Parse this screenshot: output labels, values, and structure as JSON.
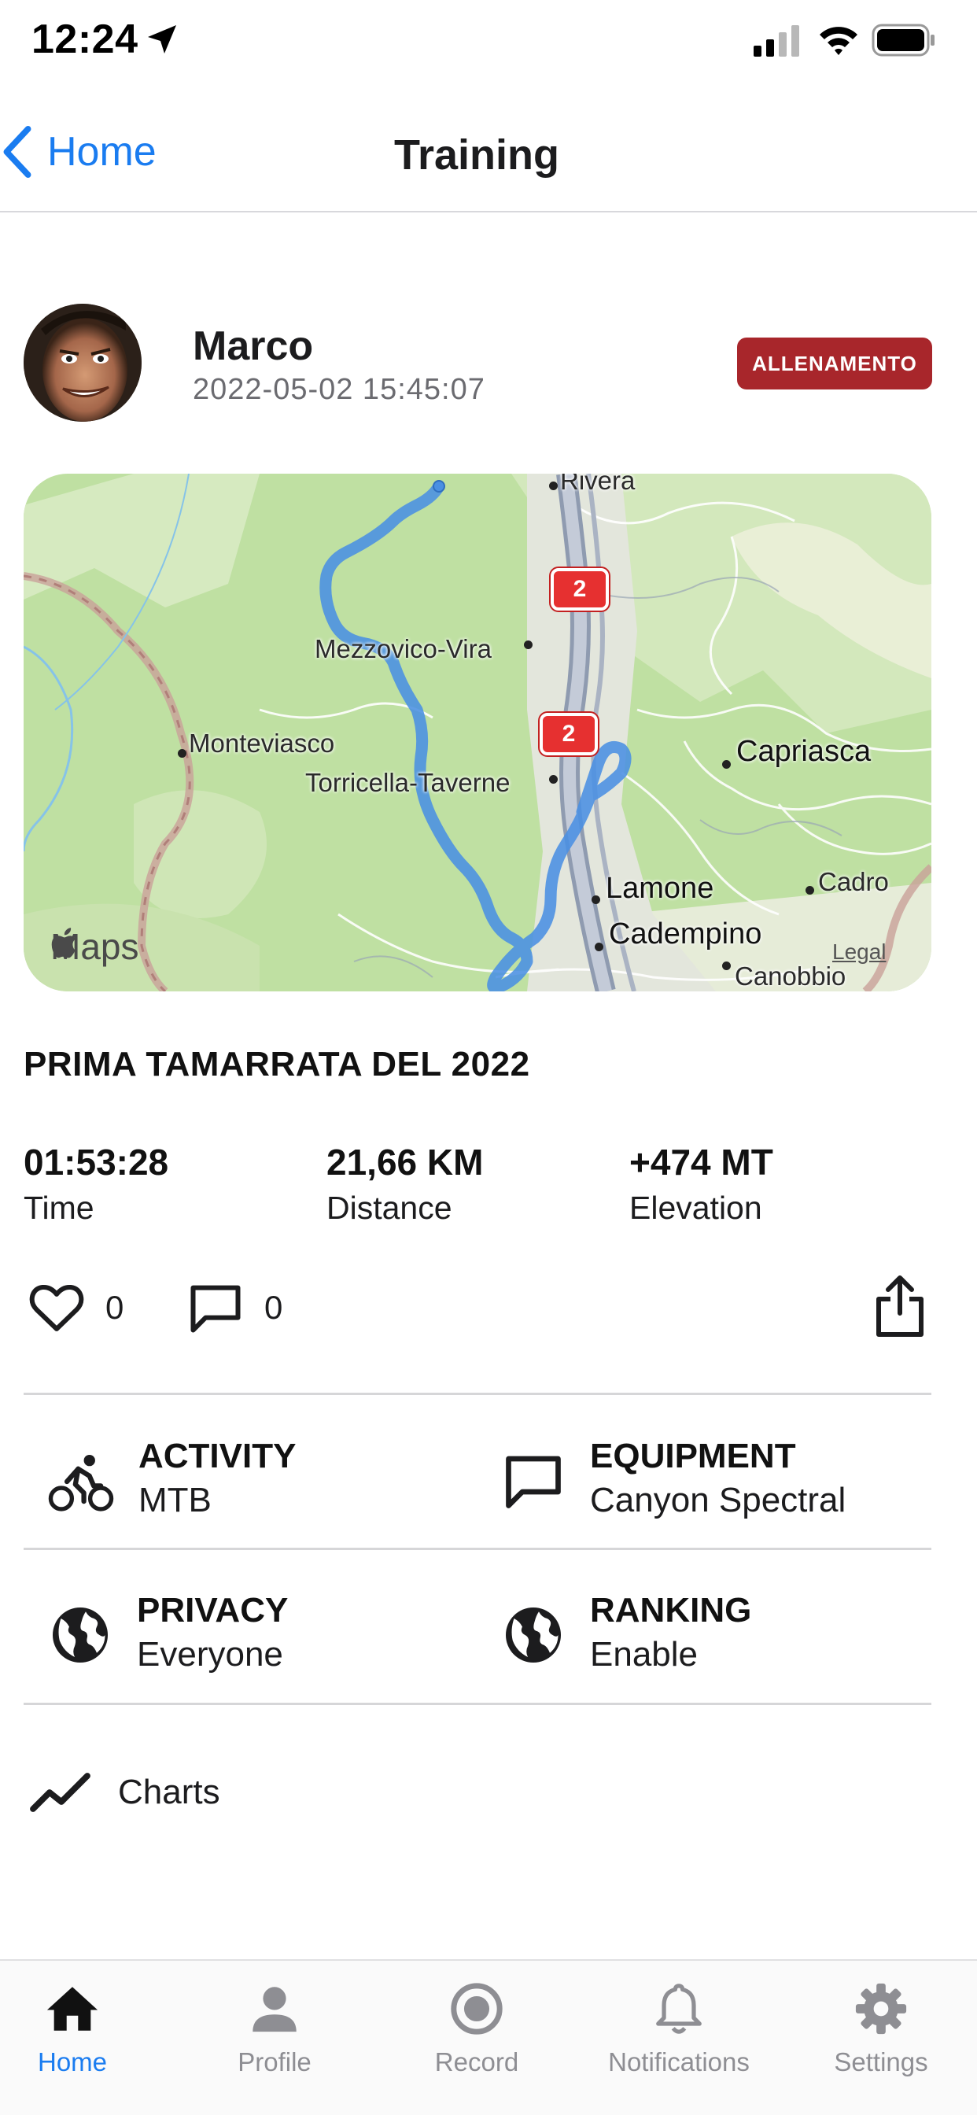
{
  "status_bar": {
    "time": "12:24"
  },
  "nav": {
    "back_label": "Home",
    "title": "Training"
  },
  "user": {
    "name": "Marco",
    "date": "2022-05-02 15:45:07",
    "badge": "ALLENAMENTO",
    "badge_color": "#a8262b"
  },
  "map": {
    "places": [
      "Rivera",
      "Mezzovico-Vira",
      "Monteviasco",
      "Torricella-Taverne",
      "Capriasca",
      "Lamone",
      "Cadempino",
      "Cadro",
      "Canobbio"
    ],
    "highway_shields": [
      "2",
      "2"
    ],
    "attribution": "Maps",
    "legal": "Legal",
    "route_color": "#4a90e2"
  },
  "activity": {
    "title": "PRIMA TAMARRATA DEL 2022",
    "stats": [
      {
        "value": "01:53:28",
        "label": "Time"
      },
      {
        "value": "21,66 KM",
        "label": "Distance"
      },
      {
        "value": "+474 MT",
        "label": "Elevation"
      }
    ]
  },
  "social": {
    "likes": "0",
    "comments": "0"
  },
  "details": {
    "activity": {
      "label": "ACTIVITY",
      "value": "MTB",
      "icon": "bike-icon"
    },
    "equipment": {
      "label": "EQUIPMENT",
      "value": "Canyon Spectral",
      "icon": "comment-icon"
    },
    "privacy": {
      "label": "PRIVACY",
      "value": "Everyone",
      "icon": "globe-icon"
    },
    "ranking": {
      "label": "RANKING",
      "value": "Enable",
      "icon": "globe-icon"
    }
  },
  "charts": {
    "label": "Charts",
    "icon": "trending-icon"
  },
  "tabs": [
    {
      "label": "Home",
      "icon": "home-icon",
      "active": true
    },
    {
      "label": "Profile",
      "icon": "person-icon",
      "active": false
    },
    {
      "label": "Record",
      "icon": "record-icon",
      "active": false
    },
    {
      "label": "Notifications",
      "icon": "bell-icon",
      "active": false
    },
    {
      "label": "Settings",
      "icon": "gear-icon",
      "active": false
    }
  ],
  "colors": {
    "accent": "#1a7cf0",
    "inactive_tab": "#8e8e93"
  }
}
